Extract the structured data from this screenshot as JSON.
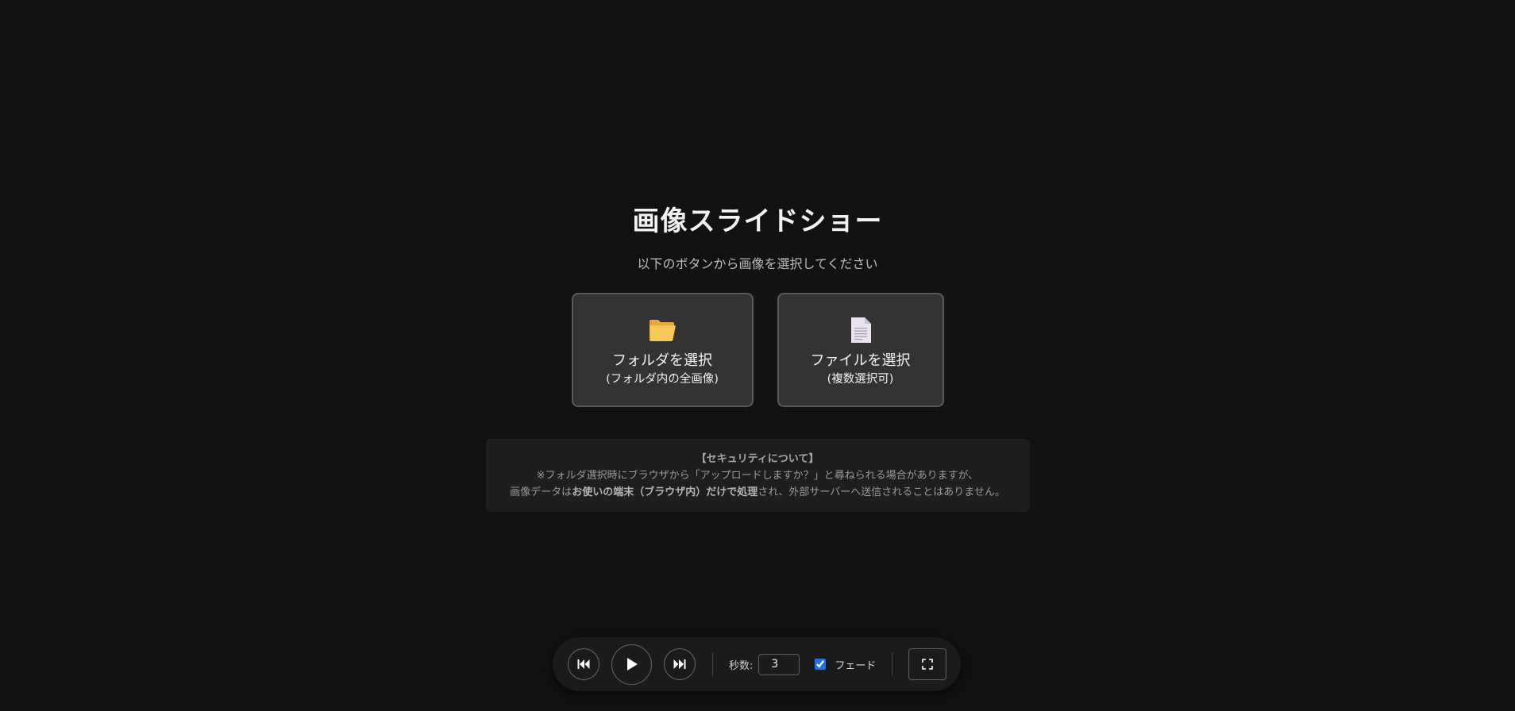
{
  "app": {
    "title": "画像スライドショー",
    "subtitle": "以下のボタンから画像を選択してください"
  },
  "choices": {
    "folder": {
      "icon": "folder-icon",
      "label": "フォルダを選択",
      "sub": "(フォルダ内の全画像)"
    },
    "files": {
      "icon": "document-icon",
      "label": "ファイルを選択",
      "sub": "(複数選択可)"
    }
  },
  "notice": {
    "title": "【セキュリティについて】",
    "line1": "※フォルダ選択時にブラウザから「アップロードしますか？」と尋ねられる場合がありますが、",
    "line2_prefix": "画像データは",
    "line2_emphasis": "お使いの端末（ブラウザ内）だけで処理",
    "line2_suffix": "され、外部サーバーへ送信されることはありません。"
  },
  "controls": {
    "prev_icon": "skip-previous-icon",
    "play_icon": "play-icon",
    "next_icon": "skip-next-icon",
    "seconds_label": "秒数:",
    "seconds_value": "3",
    "fade_label": "フェード",
    "fade_checked": true,
    "fullscreen_icon": "fullscreen-icon"
  },
  "colors": {
    "background": "#121212",
    "card": "#333333",
    "accent": "#1e73e8"
  }
}
